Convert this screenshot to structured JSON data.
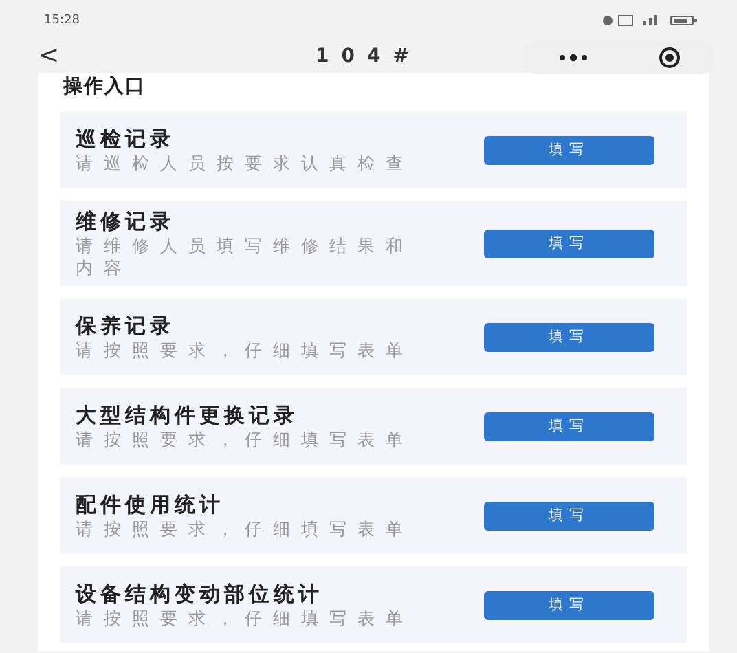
{
  "status_bar": {
    "time": "15:28"
  },
  "nav": {
    "back": "<",
    "title": "104#"
  },
  "section": {
    "title": "操作入口"
  },
  "entries": [
    {
      "title": "巡检记录",
      "subtitle": "请巡检人员按要求认真检查",
      "button": "填写"
    },
    {
      "title": "维修记录",
      "subtitle": "请维修人员填写维修结果和内容",
      "button": "填写"
    },
    {
      "title": "保养记录",
      "subtitle": "请按照要求，仔细填写表单",
      "button": "填写"
    },
    {
      "title": "大型结构件更换记录",
      "subtitle": "请按照要求，仔细填写表单",
      "button": "填写"
    },
    {
      "title": "配件使用统计",
      "subtitle": "请按照要求，仔细填写表单",
      "button": "填写"
    },
    {
      "title": "设备结构变动部位统计",
      "subtitle": "请按照要求，仔细填写表单",
      "button": "填写"
    }
  ]
}
